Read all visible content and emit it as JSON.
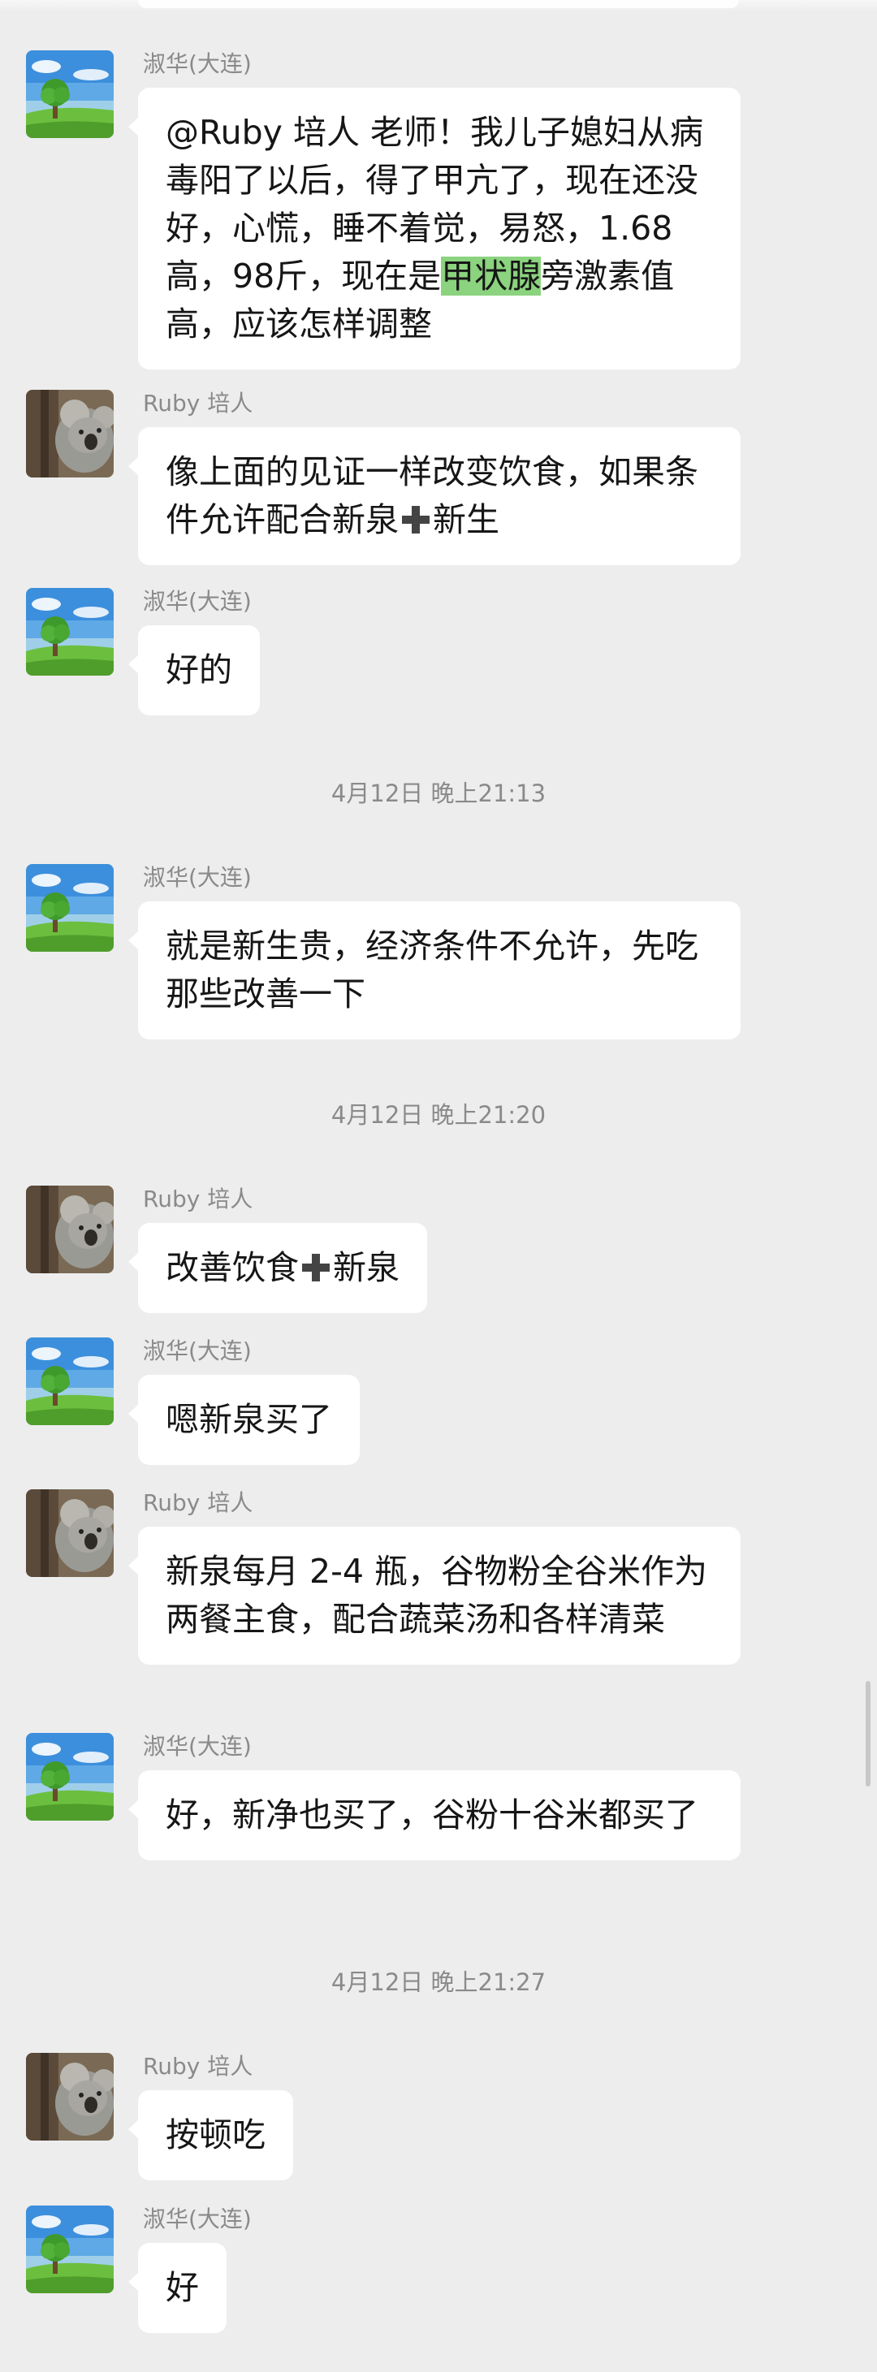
{
  "users": {
    "shuhua": "淑华(大连)",
    "ruby": "Ruby 培人"
  },
  "messages": [
    {
      "sender": "淑华(大连)",
      "text_a": "@Ruby 培人  老师！我儿子媳妇从病毒阳了以后，得了甲亢了，现在还没好，心慌，睡不着觉，易怒，1.68高，98斤，现在是",
      "highlight": "甲状腺",
      "text_b": "旁激素值高，应该怎样调整"
    },
    {
      "sender": "Ruby 培人",
      "text_a": "像上面的见证一样改变饮食，如果条件允许配合新泉",
      "text_b": "新生"
    },
    {
      "sender": "淑华(大连)",
      "text": "好的"
    },
    {
      "sender": "淑华(大连)",
      "text": "就是新生贵，经济条件不允许，先吃那些改善一下"
    },
    {
      "sender": "Ruby 培人",
      "text_a": "改善饮食",
      "text_b": "新泉"
    },
    {
      "sender": "淑华(大连)",
      "text": "嗯新泉买了"
    },
    {
      "sender": "Ruby 培人",
      "text": "新泉每月 2-4 瓶，谷物粉全谷米作为两餐主食，配合蔬菜汤和各样清菜"
    },
    {
      "sender": "淑华(大连)",
      "text": "好，新净也买了，谷粉十谷米都买了"
    },
    {
      "sender": "Ruby 培人",
      "text": "按顿吃"
    },
    {
      "sender": "淑华(大连)",
      "text": "好"
    }
  ],
  "timestamps": [
    "4月12日 晚上21:13",
    "4月12日 晚上21:20",
    "4月12日 晚上21:27"
  ],
  "icons": {
    "landscape_avatar": "tree-landscape-avatar-icon",
    "koala_avatar": "koala-avatar-icon",
    "plus": "plus-icon"
  },
  "colors": {
    "background": "#ededed",
    "bubble": "#ffffff",
    "highlight": "#8bd37e",
    "meta_text": "#8a8a8a"
  }
}
